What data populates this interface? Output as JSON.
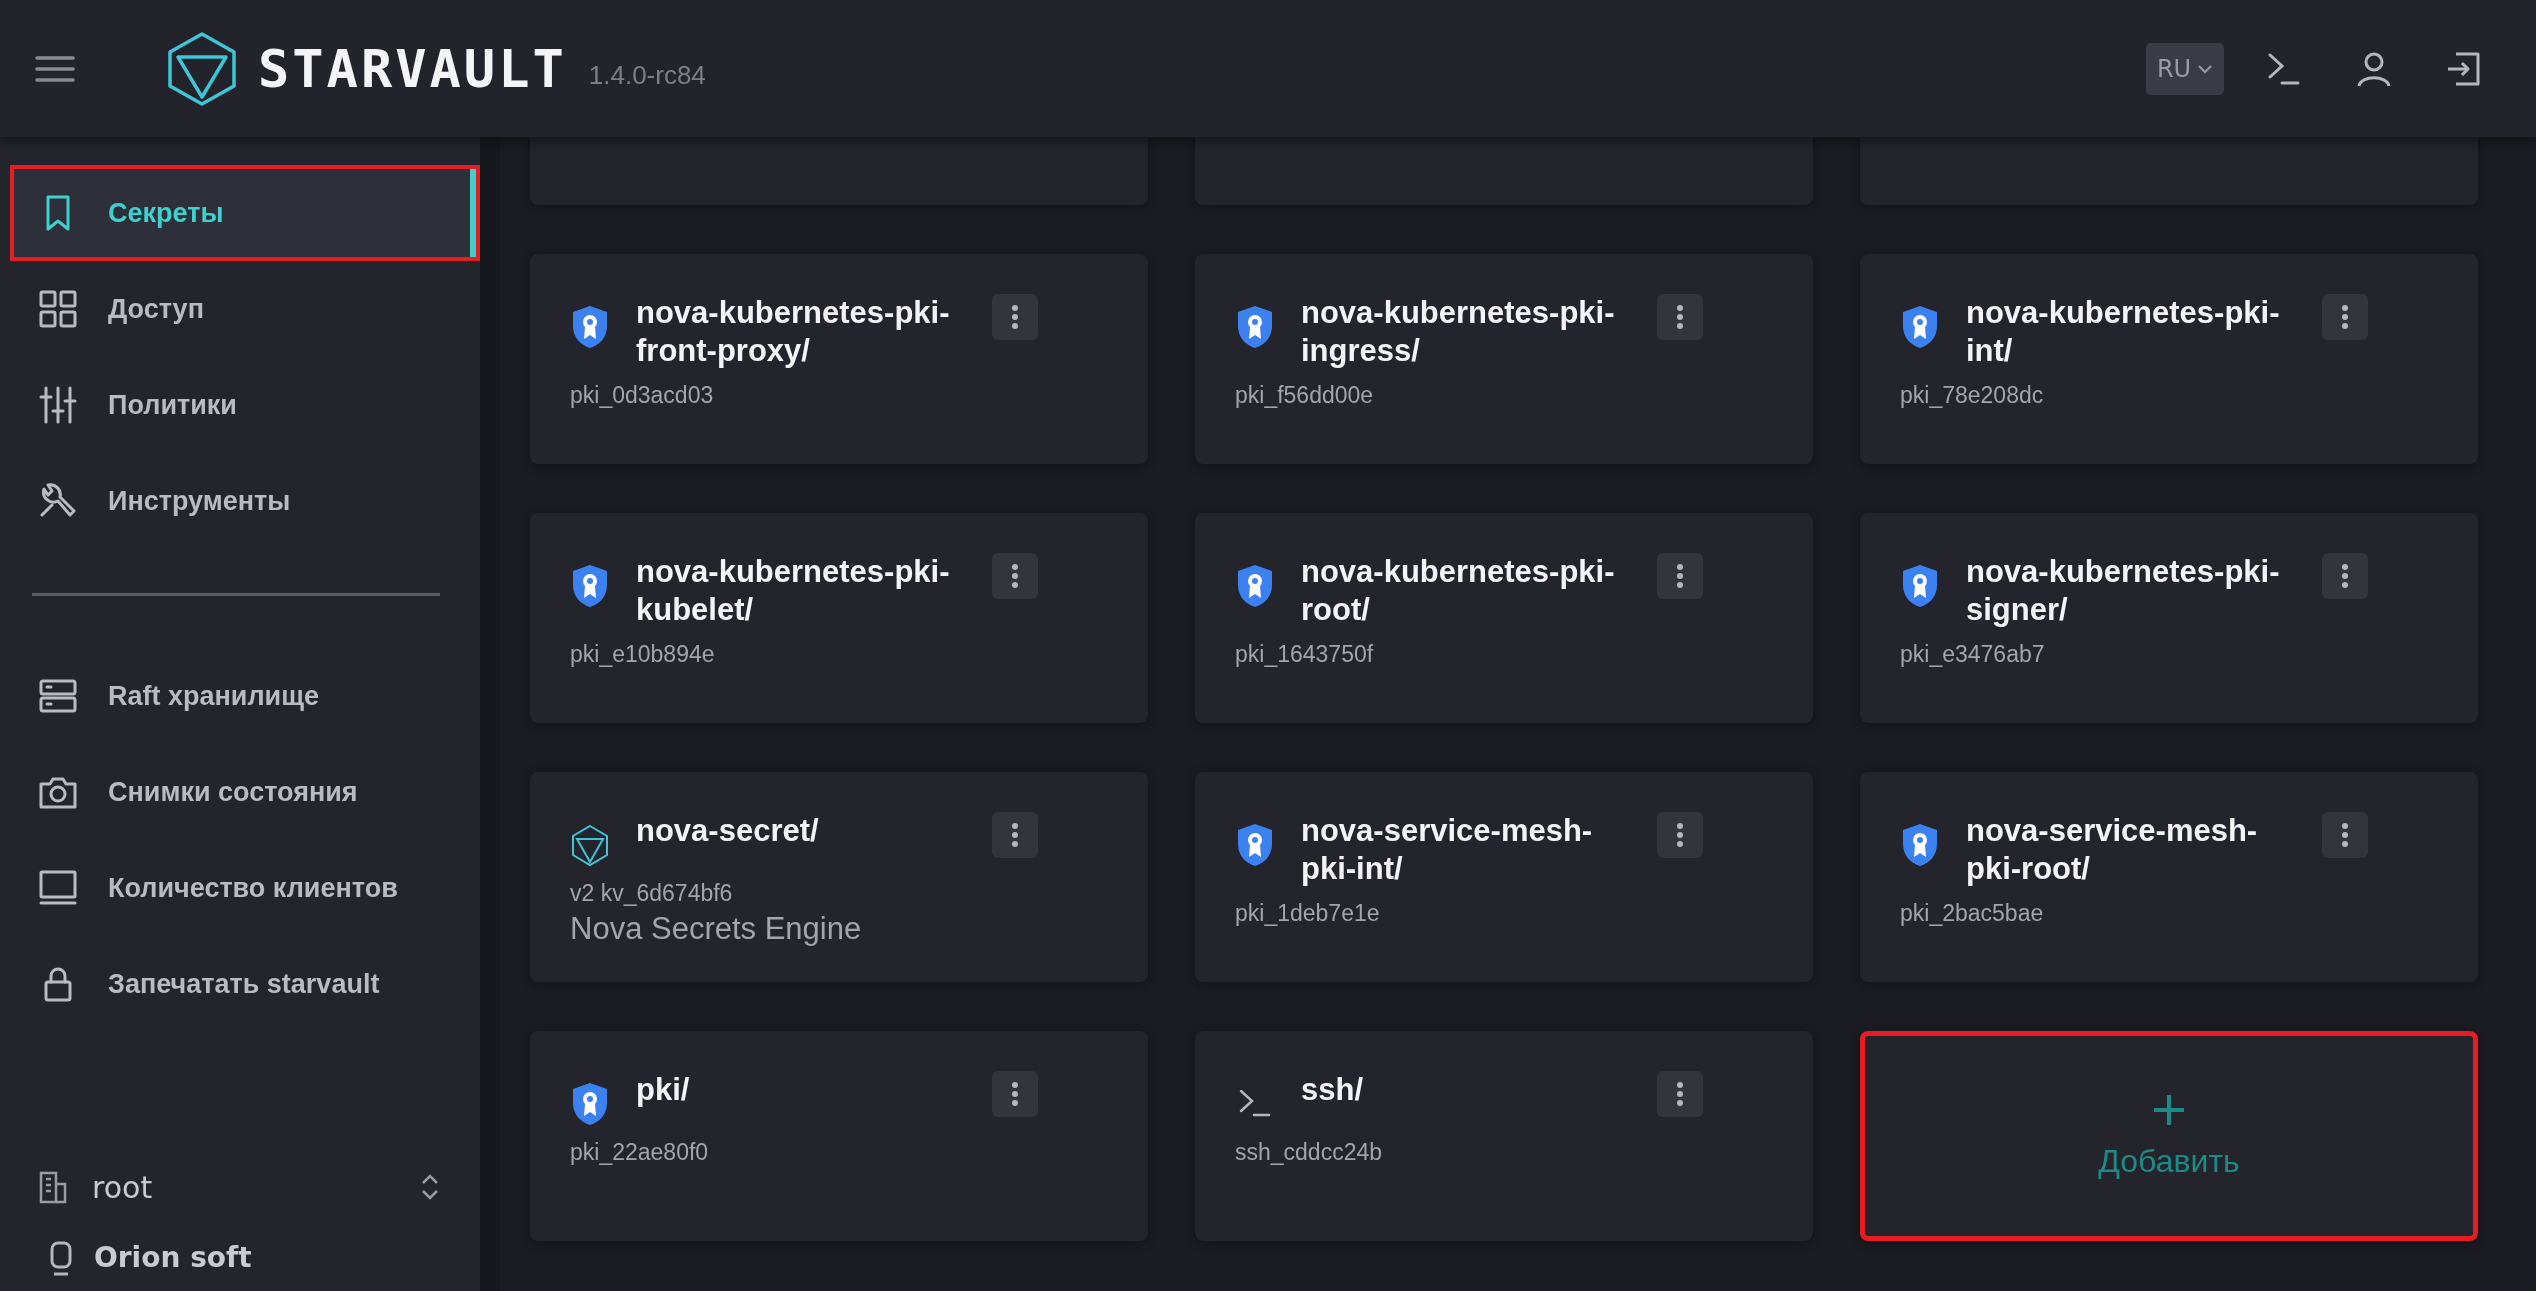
{
  "header": {
    "product": "STARVAULT",
    "version": "1.4.0-rc84",
    "language": "RU"
  },
  "sidebar": {
    "items": [
      {
        "label": "Секреты",
        "selected": true,
        "highlighted": true
      },
      {
        "label": "Доступ",
        "selected": false,
        "highlighted": false
      },
      {
        "label": "Политики",
        "selected": false,
        "highlighted": false
      },
      {
        "label": "Инструменты",
        "selected": false,
        "highlighted": false
      }
    ],
    "tools": [
      {
        "label": "Raft хранилище",
        "selected": false,
        "highlighted": false
      },
      {
        "label": "Снимки состояния",
        "selected": false,
        "highlighted": false
      },
      {
        "label": "Количество клиентов",
        "selected": false,
        "highlighted": false
      },
      {
        "label": "Запечатать starvault",
        "selected": false,
        "highlighted": false
      }
    ],
    "namespace": "root",
    "organization": "Orion soft"
  },
  "engines": [
    {
      "kind": "pki",
      "name": "nova-kubernetes-pki-front-proxy/",
      "accessor": "pki_0d3acd03"
    },
    {
      "kind": "pki",
      "name": "nova-kubernetes-pki-ingress/",
      "accessor": "pki_f56dd00e"
    },
    {
      "kind": "pki",
      "name": "nova-kubernetes-pki-int/",
      "accessor": "pki_78e208dc"
    },
    {
      "kind": "pki",
      "name": "nova-kubernetes-pki-kubelet/",
      "accessor": "pki_e10b894e"
    },
    {
      "kind": "pki",
      "name": "nova-kubernetes-pki-root/",
      "accessor": "pki_1643750f"
    },
    {
      "kind": "pki",
      "name": "nova-kubernetes-pki-signer/",
      "accessor": "pki_e3476ab7"
    },
    {
      "kind": "kv",
      "name": "nova-secret/",
      "accessor": "v2 kv_6d674bf6",
      "description": "Nova Secrets Engine"
    },
    {
      "kind": "pki",
      "name": "nova-service-mesh-pki-int/",
      "accessor": "pki_1deb7e1e"
    },
    {
      "kind": "pki",
      "name": "nova-service-mesh-pki-root/",
      "accessor": "pki_2bac5bae"
    },
    {
      "kind": "pki",
      "name": "pki/",
      "accessor": "pki_22ae80f0"
    },
    {
      "kind": "ssh",
      "name": "ssh/",
      "accessor": "ssh_cddcc24b"
    }
  ],
  "add_card": {
    "label": "Добавить",
    "highlighted": true
  }
}
